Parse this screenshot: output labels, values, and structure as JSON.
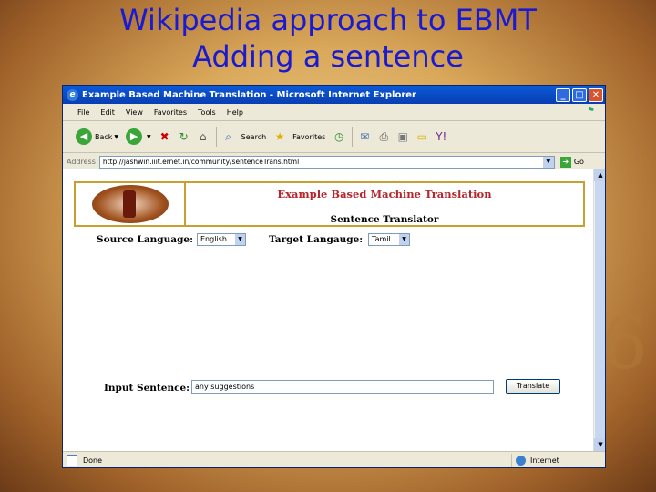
{
  "slide": {
    "title_line1": "Wikipedia approach to EBMT",
    "title_line2": "Adding a sentence",
    "decor_digit": "6"
  },
  "window": {
    "title": "Example Based Machine Translation - Microsoft Internet Explorer",
    "minimize": "_",
    "maximize": "□",
    "close": "✕"
  },
  "menu": [
    "File",
    "Edit",
    "View",
    "Favorites",
    "Tools",
    "Help"
  ],
  "toolbar": {
    "back_label": "Back",
    "search_label": "Search",
    "favorites_label": "Favorites"
  },
  "address": {
    "label": "Address",
    "url": "http://jashwin.iiit.ernet.in/community/sentenceTrans.html",
    "go_label": "Go"
  },
  "page": {
    "header_title": "Example Based Machine Translation",
    "header_subtitle": "Sentence Translator",
    "source_label": "Source Language:",
    "source_value": "English",
    "target_label": "Target Langauge:",
    "target_value": "Tamil",
    "input_label": "Input Sentence:",
    "input_value": "any suggestions",
    "translate_button": "Translate"
  },
  "status": {
    "left": "Done",
    "zone": "Internet"
  }
}
